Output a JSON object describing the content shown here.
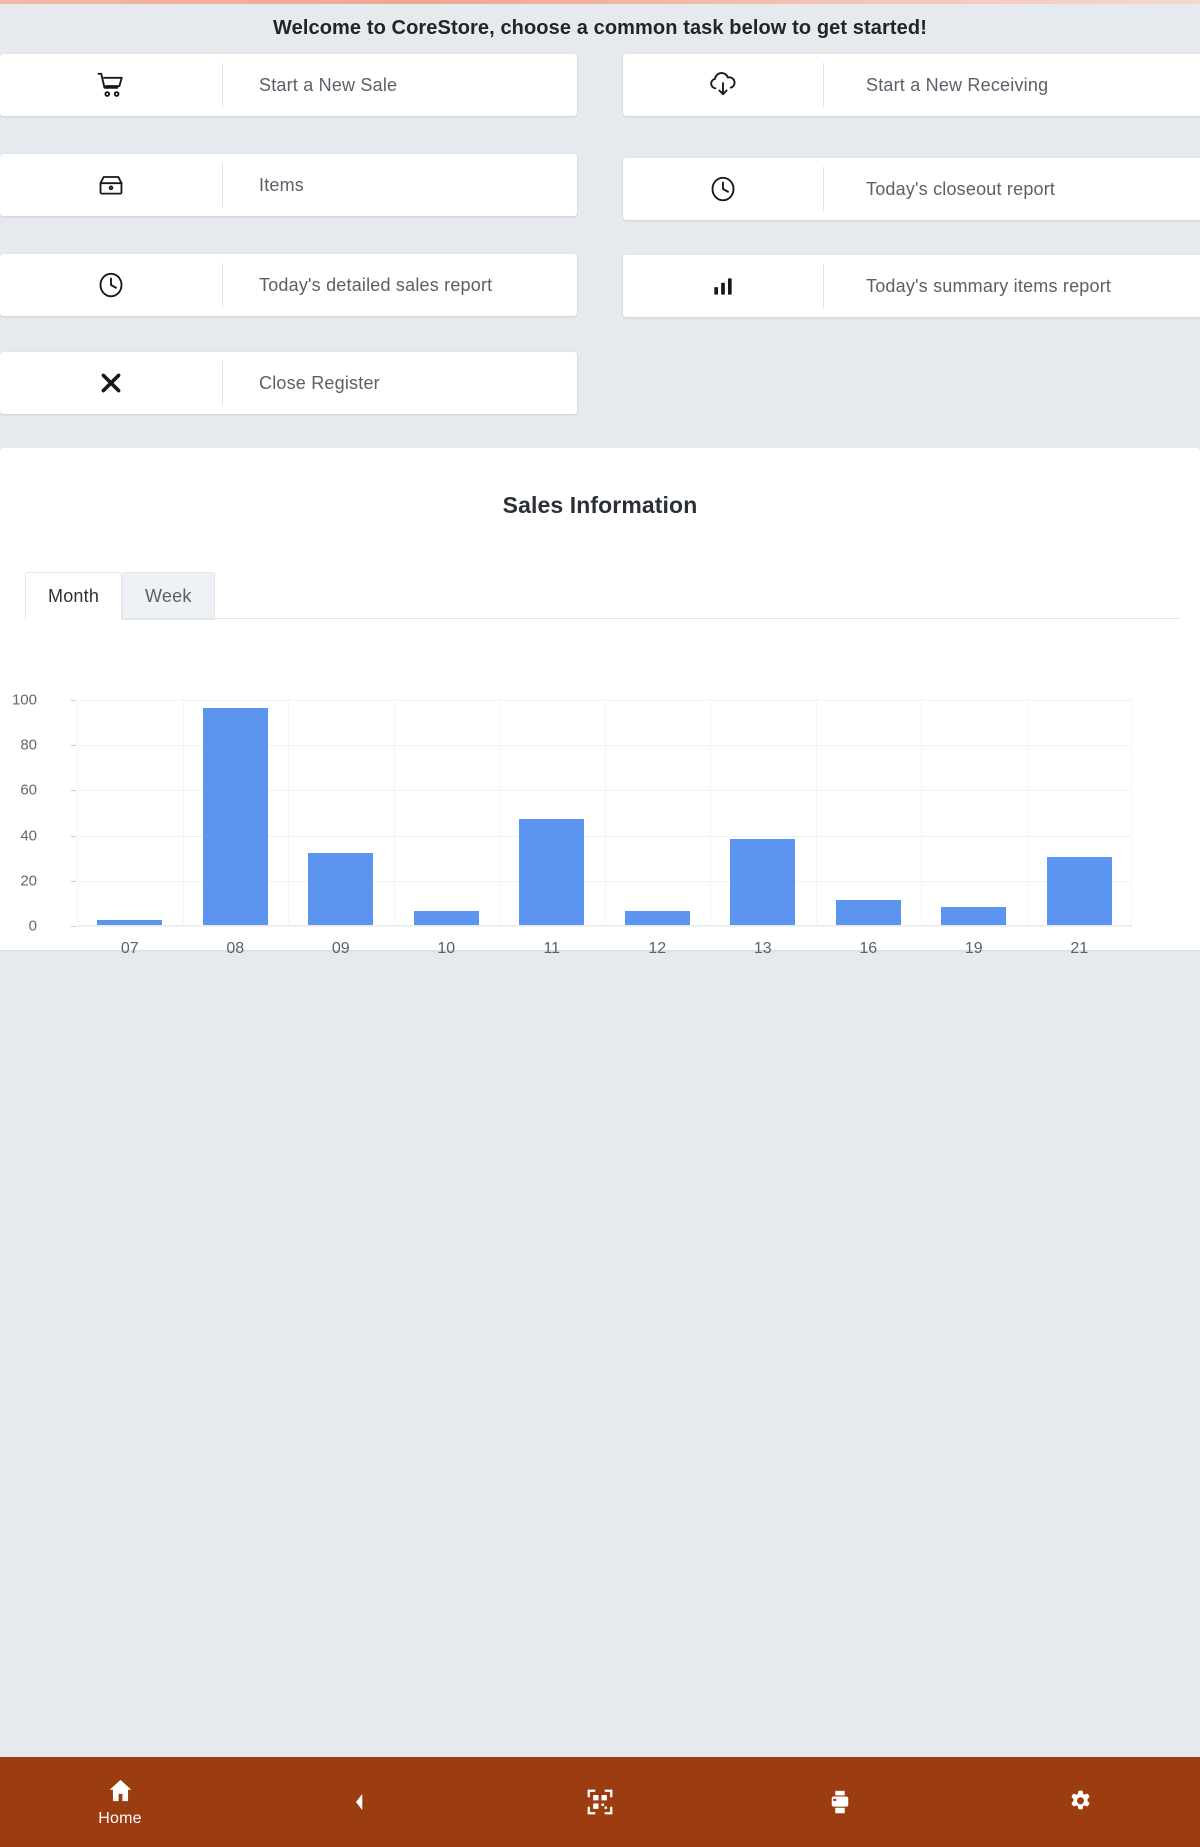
{
  "header": {
    "welcome_text": "Welcome to CoreStore, choose a common task below to get started!"
  },
  "tasks": [
    {
      "label": "Start a New Sale",
      "icon": "shopping-cart-icon"
    },
    {
      "label": "Start a New Receiving",
      "icon": "cloud-download-icon"
    },
    {
      "label": "Items",
      "icon": "inbox-box-icon"
    },
    {
      "label": "Today's closeout report",
      "icon": "clock-icon"
    },
    {
      "label": "Today's detailed sales report",
      "icon": "clock-icon"
    },
    {
      "label": "Today's summary items report",
      "icon": "bar-chart-icon"
    },
    {
      "label": "Close Register",
      "icon": "close-x-icon"
    }
  ],
  "sales": {
    "title": "Sales Information",
    "tabs": [
      {
        "label": "Month",
        "active": true
      },
      {
        "label": "Week",
        "active": false
      }
    ]
  },
  "chart_data": {
    "type": "bar",
    "title": "Sales Information",
    "xlabel": "",
    "ylabel": "",
    "categories": [
      "07",
      "08",
      "09",
      "10",
      "11",
      "12",
      "13",
      "16",
      "19",
      "21"
    ],
    "values": [
      2,
      96,
      32,
      6,
      47,
      6,
      38,
      11,
      8,
      30
    ],
    "ylim": [
      0,
      100
    ],
    "yticks": [
      0,
      20,
      40,
      60,
      80,
      100
    ],
    "grid": true,
    "legend": "none",
    "bar_color": "#5b95f0"
  },
  "bottom_nav": [
    {
      "label": "Home",
      "icon": "home-icon"
    },
    {
      "label": "",
      "icon": "back-chevron-icon"
    },
    {
      "label": "",
      "icon": "qr-scan-icon"
    },
    {
      "label": "",
      "icon": "printer-icon"
    },
    {
      "label": "",
      "icon": "gear-icon"
    }
  ],
  "colors": {
    "accent": "#9b3d10",
    "bar": "#5b95f0",
    "page_bg": "#e6eaef",
    "card_bg": "#ffffff"
  }
}
